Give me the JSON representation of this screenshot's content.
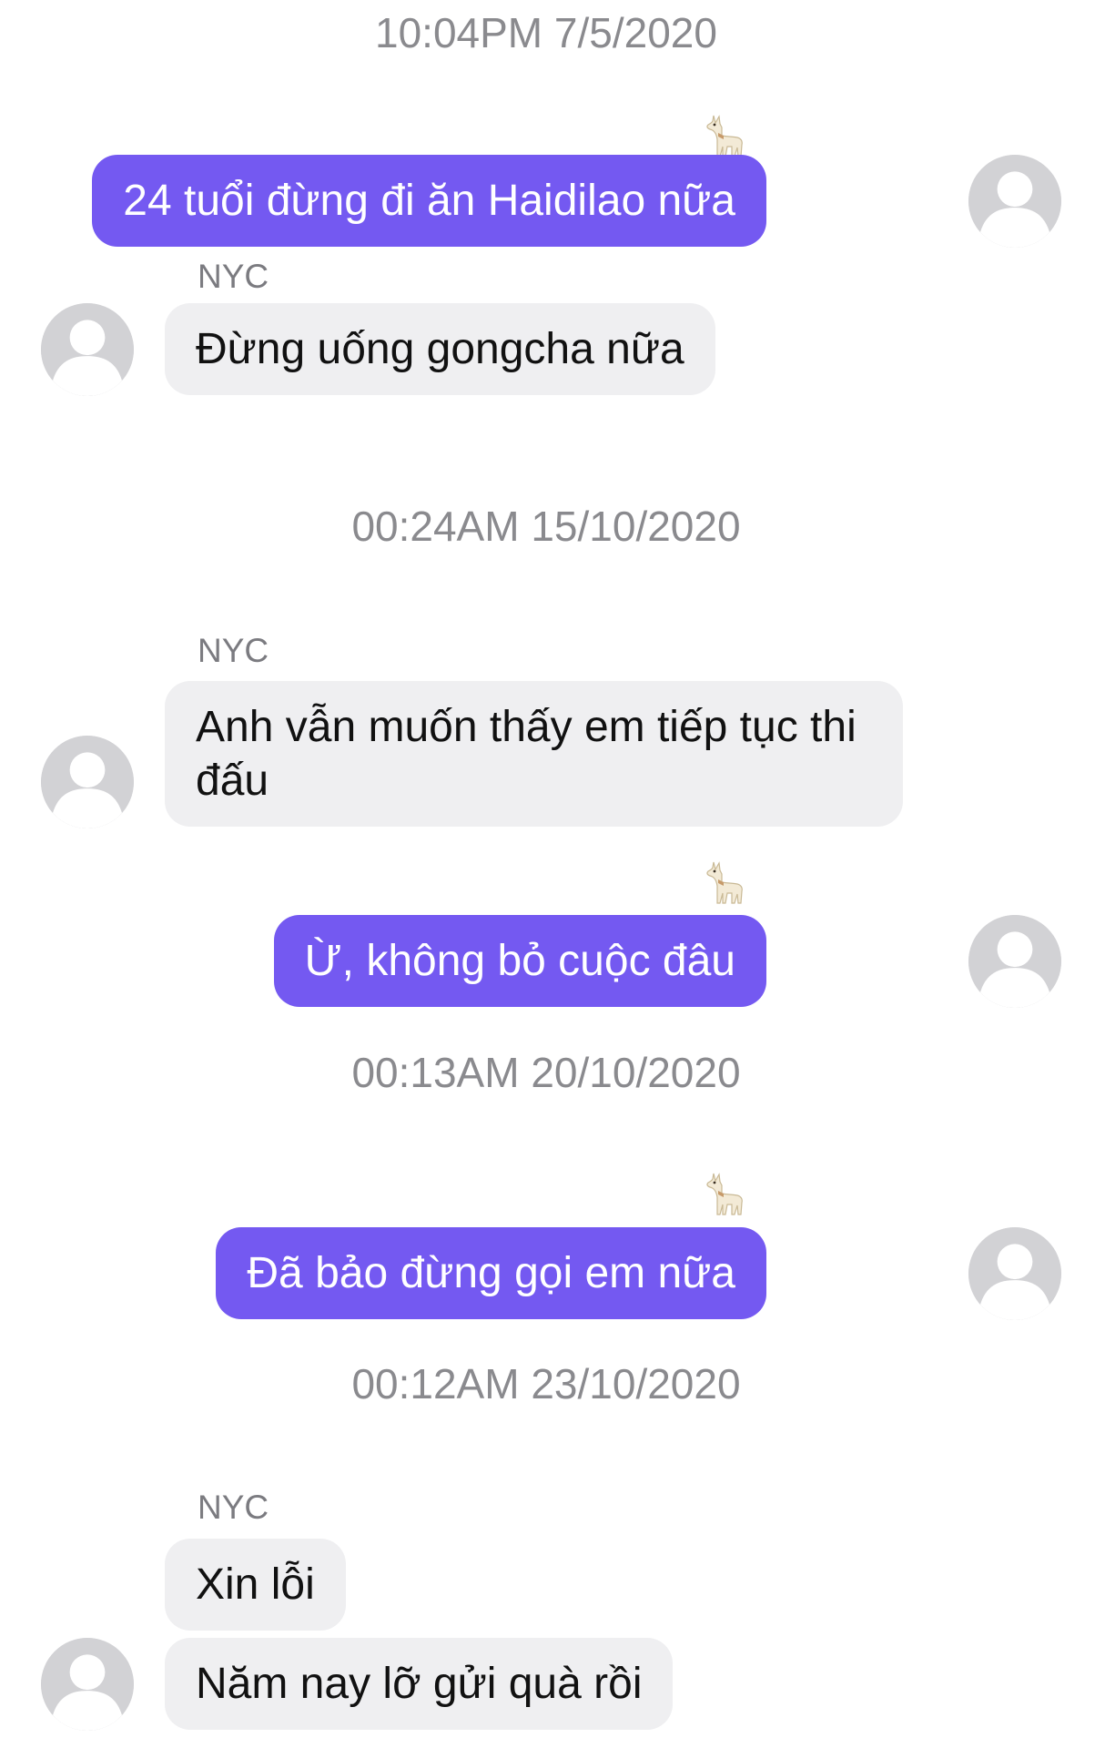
{
  "conversation": {
    "timestamps": [
      "10:04PM 7/5/2020",
      "00:24AM 15/10/2020",
      "00:13AM 20/10/2020",
      "00:12AM 23/10/2020"
    ],
    "contact_name": "NYC",
    "reaction_icon": "llama-emoji-icon",
    "colors": {
      "outgoing_bubble": "#7459f1",
      "incoming_bubble": "#efeff1",
      "timestamp_text": "#8a8a8e",
      "avatar": "#d2d2d5"
    },
    "messages": [
      {
        "direction": "outgoing",
        "text": "24 tuổi đừng đi ăn Haidilao nữa",
        "reaction": "llama"
      },
      {
        "direction": "incoming",
        "sender": "NYC",
        "text": "Đừng uống gongcha nữa"
      },
      {
        "direction": "incoming",
        "sender": "NYC",
        "text": "Anh vẫn muốn thấy em tiếp tục thi đấu"
      },
      {
        "direction": "outgoing",
        "text": "Ừ, không bỏ cuộc đâu",
        "reaction": "llama"
      },
      {
        "direction": "outgoing",
        "text": "Đã bảo đừng gọi em nữa",
        "reaction": "llama"
      },
      {
        "direction": "incoming",
        "sender": "NYC",
        "text": "Xin lỗi"
      },
      {
        "direction": "incoming",
        "sender": "NYC",
        "text": "Năm nay lỡ gửi quà rồi"
      }
    ]
  }
}
